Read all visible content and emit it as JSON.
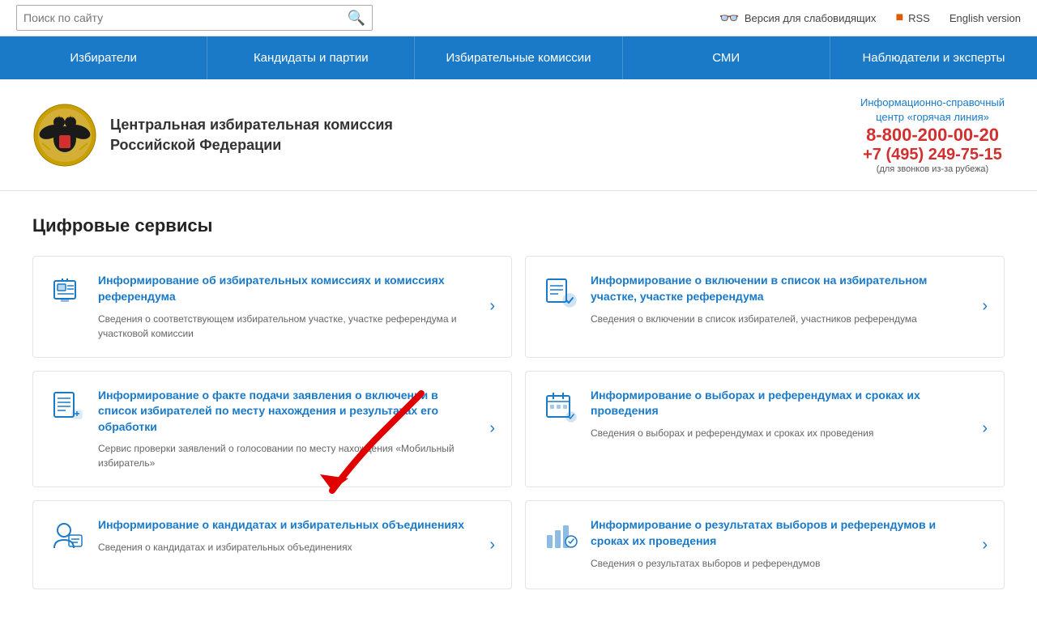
{
  "topbar": {
    "search_placeholder": "Поиск по сайту",
    "vision_label": "Версия для слабовидящих",
    "rss_label": "RSS",
    "english_label": "English version"
  },
  "nav": {
    "items": [
      "Избиратели",
      "Кандидаты и партии",
      "Избирательные комиссии",
      "СМИ",
      "Наблюдатели и эксперты"
    ]
  },
  "header": {
    "org_line1": "Центральная избирательная комиссия",
    "org_line2": "Российской Федерации",
    "hotline_label1": "Информационно-справочный",
    "hotline_label2": "центр «горячая линия»",
    "hotline_number1": "8-800-200-00-20",
    "hotline_number2": "+7 (495) 249-75-15",
    "hotline_note": "(для звонков из-за рубежа)"
  },
  "main": {
    "section_title": "Цифровые сервисы",
    "cards": [
      {
        "title": "Информирование об избирательных комиссиях и комиссиях референдума",
        "desc": "Сведения о соответствующем избирательном участке, участке референдума и участковой комиссии",
        "icon": "commission"
      },
      {
        "title": "Информирование о включении в список на избирательном участке, участке референдума",
        "desc": "Сведения о включении в список избирателей, участников референдума",
        "icon": "list"
      },
      {
        "title": "Информирование о факте подачи заявления о включении в список избирателей по месту нахождения и результатах его обработки",
        "desc": "Сервис проверки заявлений о голосовании по месту нахождения «Мобильный избиратель»",
        "icon": "document"
      },
      {
        "title": "Информирование о выборах и референдумах и сроках их проведения",
        "desc": "Сведения о выборах и референдумах и сроках их проведения",
        "icon": "calendar"
      },
      {
        "title": "Информирование о кандидатах и избирательных объединениях",
        "desc": "Сведения о кандидатах и избирательных объединениях",
        "icon": "candidate"
      },
      {
        "title": "Информирование о результатах выборов и референдумов и сроках их проведения",
        "desc": "Сведения о результатах выборов и референдумов",
        "icon": "results"
      }
    ]
  }
}
